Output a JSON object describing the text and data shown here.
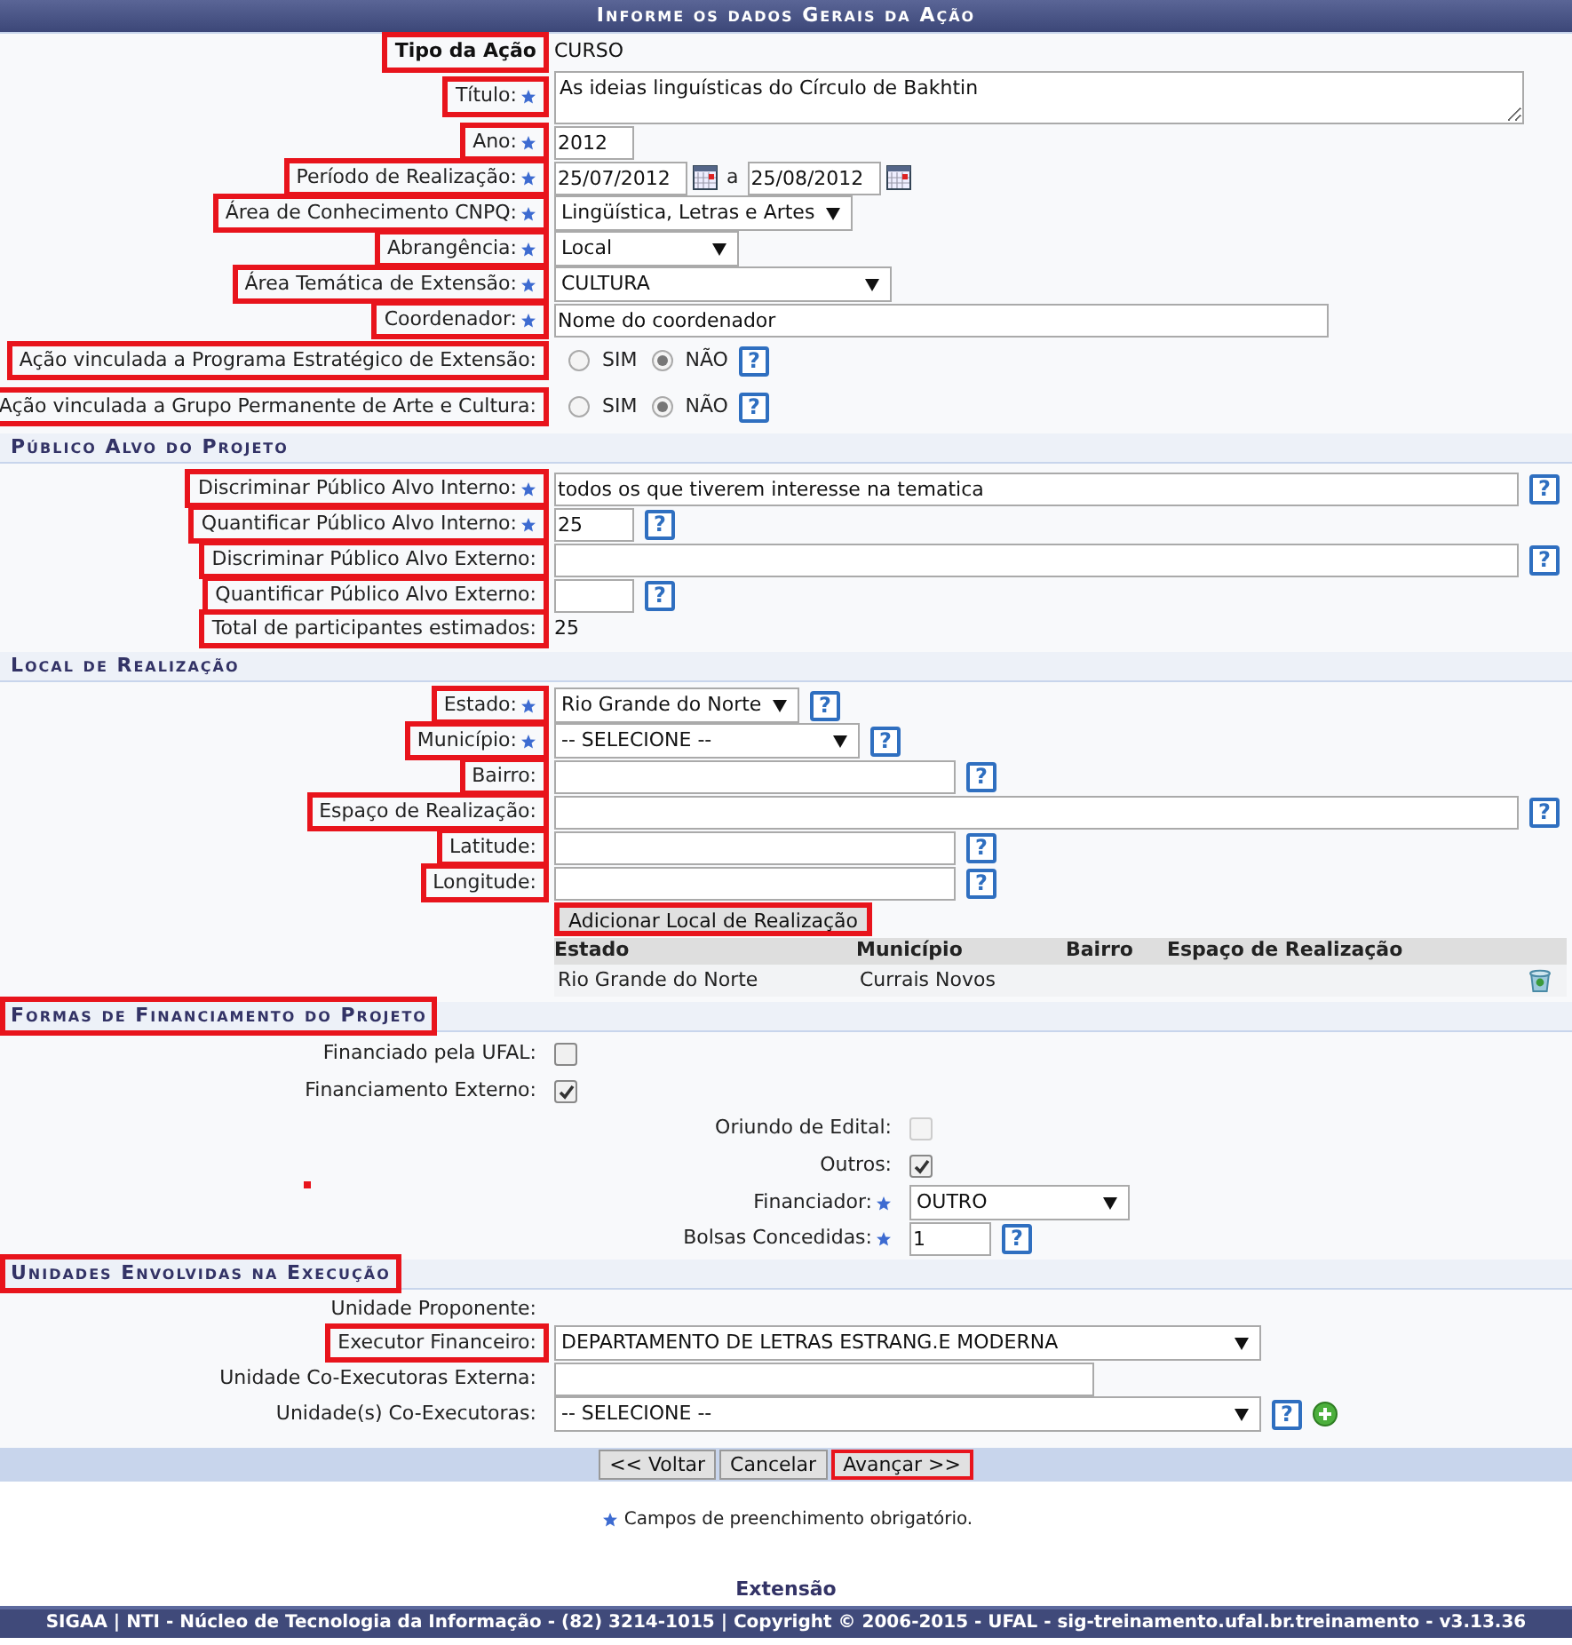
{
  "header": {
    "title": "Informe os dados Gerais da Ação"
  },
  "sections": [
    {
      "rows": [
        {
          "kind": "action_type",
          "label": "Tipo da Ação",
          "highlighted": true,
          "value": "CURSO"
        },
        {
          "kind": "textarea",
          "label": "Título:",
          "required": true,
          "highlighted": true,
          "value": "As ideias linguísticas do Círculo de Bakhtin"
        },
        {
          "kind": "input",
          "label": "Ano:",
          "required": true,
          "highlighted": true,
          "value": "2012"
        },
        {
          "kind": "date_range",
          "label": "Período de Realização:",
          "required": true,
          "highlighted": true,
          "start": "25/07/2012",
          "separator": "a",
          "end": "25/08/2012"
        },
        {
          "kind": "select",
          "label": "Área de Conhecimento CNPQ:",
          "required": true,
          "highlighted": true,
          "value": "Lingüística, Letras e Artes"
        },
        {
          "kind": "select",
          "label": "Abrangência:",
          "required": true,
          "highlighted": true,
          "value": "Local"
        },
        {
          "kind": "select",
          "label": "Área Temática de Extensão:",
          "required": true,
          "highlighted": true,
          "value": "CULTURA"
        },
        {
          "kind": "input",
          "label": "Coordenador:",
          "required": true,
          "highlighted": true,
          "value": "Nome do coordenador"
        },
        {
          "kind": "radio",
          "label": "Ação vinculada a Programa Estratégico de Extensão:",
          "required": false,
          "highlighted": true,
          "options": [
            {
              "label": "SIM",
              "selected": false
            },
            {
              "label": "NÃO",
              "selected": true
            }
          ],
          "help": "?"
        },
        {
          "kind": "radio",
          "label": "Ação vinculada a Grupo Permanente de Arte e Cultura:",
          "required": false,
          "highlighted": true,
          "options": [
            {
              "label": "SIM",
              "selected": false
            },
            {
              "label": "NÃO",
              "selected": true
            }
          ],
          "help": "?"
        }
      ]
    },
    {
      "title": "Público Alvo do Projeto",
      "highlighted": false,
      "rows": [
        {
          "kind": "input",
          "label": "Discriminar Público Alvo Interno:",
          "required": true,
          "highlighted": true,
          "value": "todos os que tiverem interesse na tematica",
          "help": "?"
        },
        {
          "kind": "input",
          "label": "Quantificar Público Alvo Interno:",
          "required": true,
          "highlighted": true,
          "value": "25",
          "help": "?"
        },
        {
          "kind": "input",
          "label": "Discriminar Público Alvo Externo:",
          "required": false,
          "highlighted": true,
          "help": "?"
        },
        {
          "kind": "input",
          "label": "Quantificar Público Alvo Externo:",
          "required": false,
          "highlighted": true,
          "help": "?"
        },
        {
          "kind": "static",
          "label": "Total de participantes estimados:",
          "required": false,
          "highlighted": true,
          "value": "25"
        }
      ]
    },
    {
      "title": "Local de Realização",
      "highlighted": false,
      "rows": [
        {
          "kind": "select",
          "label": "Estado:",
          "required": true,
          "highlighted": true,
          "value": "Rio Grande do Norte",
          "help": "?"
        },
        {
          "kind": "select",
          "label": "Município:",
          "required": true,
          "highlighted": true,
          "value": "-- SELECIONE --",
          "help": "?"
        },
        {
          "kind": "input",
          "label": "Bairro:",
          "required": false,
          "highlighted": true,
          "help": "?"
        },
        {
          "kind": "input",
          "label": "Espaço de Realização:",
          "required": false,
          "highlighted": true,
          "help": "?"
        },
        {
          "kind": "input",
          "label": "Latitude:",
          "required": false,
          "highlighted": true,
          "help": "?"
        },
        {
          "kind": "input",
          "label": "Longitude:",
          "required": false,
          "highlighted": true,
          "help": "?"
        },
        {
          "kind": "button",
          "label": "Adicionar Local de Realização",
          "highlighted": true
        },
        {
          "kind": "table",
          "columns": [
            "Estado",
            "Município",
            "Bairro",
            "Espaço de Realização"
          ],
          "rows": [
            {
              "cells": [
                "Rio Grande do Norte",
                "Currais Novos"
              ]
            }
          ]
        }
      ]
    },
    {
      "title": "Formas de Financiamento do Projeto",
      "highlighted": true,
      "rows": [
        {
          "kind": "checkbox",
          "label": "Financiado pela UFAL:",
          "checked": false,
          "disabled": false
        },
        {
          "kind": "checkbox",
          "label": "Financiamento Externo:",
          "checked": true,
          "disabled": false,
          "children": [
            {
              "kind": "checkbox",
              "label": "Oriundo de Edital:",
              "checked": false,
              "disabled": true
            },
            {
              "kind": "checkbox",
              "label": "Outros:",
              "checked": true,
              "disabled": false
            },
            {
              "kind": "select",
              "label": "Financiador:",
              "required": true,
              "highlighted": false,
              "value": "OUTRO"
            },
            {
              "kind": "input",
              "label": "Bolsas Concedidas:",
              "required": true,
              "highlighted": false,
              "value": "1",
              "help": "?"
            }
          ]
        }
      ]
    },
    {
      "title": "Unidades Envolvidas na Execução",
      "highlighted": true,
      "rows": [
        {
          "kind": "static",
          "label": "Unidade Proponente:",
          "required": false,
          "highlighted": false
        },
        {
          "kind": "select",
          "label": "Executor Financeiro:",
          "required": false,
          "highlighted": true,
          "value": "DEPARTAMENTO DE LETRAS ESTRANG.E MODERNA"
        },
        {
          "kind": "input",
          "label": "Unidade Co-Executoras Externa:",
          "required": false,
          "highlighted": false
        },
        {
          "kind": "select",
          "label": "Unidade(s) Co-Executoras:",
          "required": false,
          "highlighted": false,
          "value": "-- SELECIONE --",
          "help": "?",
          "addable": true
        }
      ]
    }
  ],
  "buttons": [
    {
      "label": "<< Voltar",
      "highlighted": false
    },
    {
      "label": "Cancelar",
      "highlighted": false
    },
    {
      "label": "Avançar >>",
      "highlighted": true
    }
  ],
  "note": "Campos de preenchimento obrigatório.",
  "module": "Extensão",
  "footer": "SIGAA | NTI - Núcleo de Tecnologia da Informação - (82) 3214-1015 | Copyright © 2006-2015 - UFAL - sig-treinamento.ufal.br.treinamento - v3.13.36"
}
